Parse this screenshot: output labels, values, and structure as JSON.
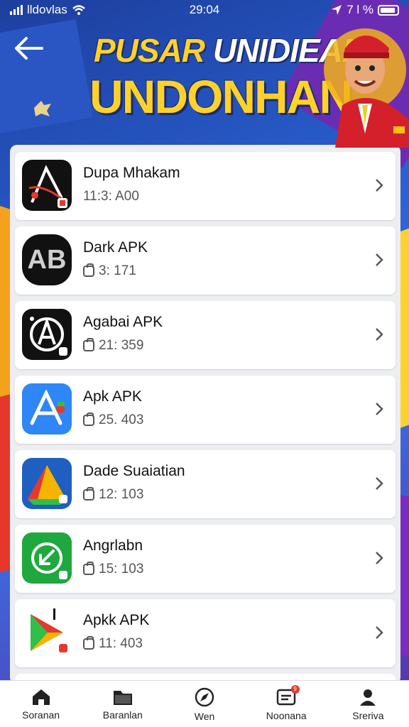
{
  "status_bar": {
    "carrier": "lldovlas",
    "time": "29:04",
    "battery_text": "7 l %"
  },
  "header": {
    "title_part1": "PUSAR",
    "title_part2": "UNIDIEAN",
    "title_line2": "UNDONHAN"
  },
  "apps": [
    {
      "name": "Dupa Mhakam",
      "meta": "11:3: A00",
      "icon": "stylus-a-icon",
      "colors": [
        "#111111",
        "#e23a2e"
      ]
    },
    {
      "name": "Dark APK",
      "meta": "3: 171",
      "icon": "ab-icon",
      "colors": [
        "#111111",
        "#d9d9d9"
      ]
    },
    {
      "name": "Agabai APK",
      "meta": "21: 359",
      "icon": "circle-a-icon",
      "colors": [
        "#111111",
        "#ffffff"
      ]
    },
    {
      "name": "Apk APK",
      "meta": "25. 403",
      "icon": "blue-a-icon",
      "colors": [
        "#2f86f6",
        "#ffffff"
      ]
    },
    {
      "name": "Dade Suaiatian",
      "meta": "12: 103",
      "icon": "triangle-drive-icon",
      "colors": [
        "#1f5fbf",
        "#f4b400"
      ]
    },
    {
      "name": "Angrlabn",
      "meta": "15: 103",
      "icon": "green-arrow-icon",
      "colors": [
        "#1fa83e",
        "#ffffff"
      ]
    },
    {
      "name": "Apkk APK",
      "meta": "11: 403",
      "icon": "play-icon",
      "colors": [
        "#ffffff",
        "#e23a2e"
      ]
    }
  ],
  "nav": [
    {
      "label": "Soranan",
      "icon": "home-icon"
    },
    {
      "label": "Baranlan",
      "icon": "folder-icon"
    },
    {
      "label": "Wen",
      "icon": "compass-icon"
    },
    {
      "label": "Noonana",
      "icon": "notification-icon",
      "badge": "9"
    },
    {
      "label": "Sreriva",
      "icon": "profile-icon"
    }
  ],
  "colors": {
    "accent_yellow": "#ffd22b",
    "header_blue": "#2b63d6",
    "panel_bg": "#eceef2"
  }
}
